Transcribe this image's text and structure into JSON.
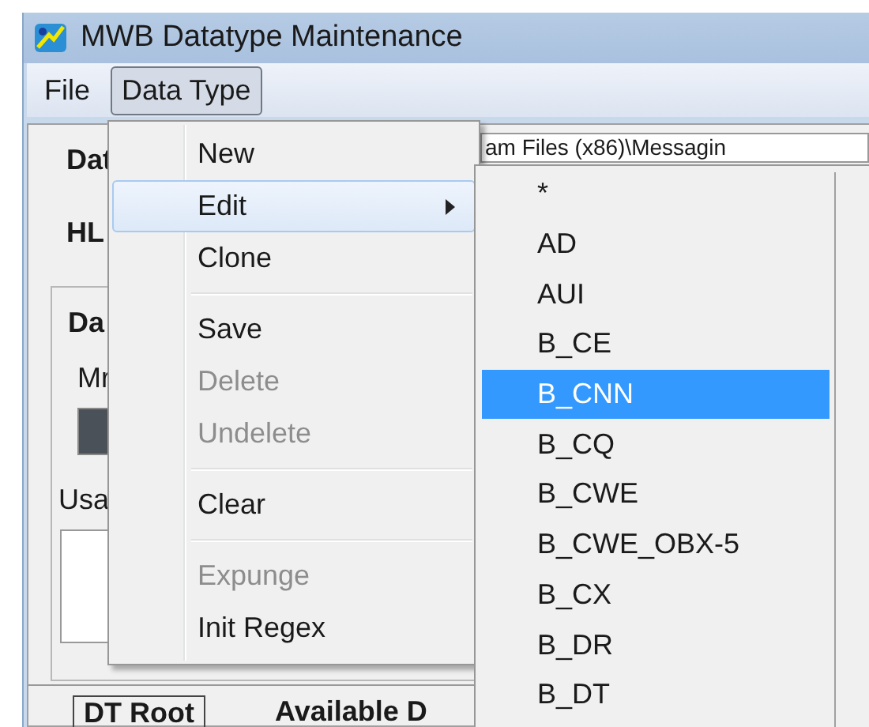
{
  "window": {
    "title": "MWB Datatype Maintenance"
  },
  "menu_bar": [
    {
      "label": "File",
      "selected": false
    },
    {
      "label": "Data Type",
      "selected": true
    }
  ],
  "form": {
    "label_1": "Dat",
    "path_field": "am Files (x86)\\Messagin",
    "label_2": "HL",
    "group_title": "Da",
    "group_label_1": "Mr",
    "group_label_2": "Usa"
  },
  "bottom_bar": {
    "tab": "DT Root",
    "label": "Available D"
  },
  "menu": {
    "items": [
      {
        "kind": "item",
        "label": "New",
        "disabled": false,
        "selected": false,
        "submenu": false
      },
      {
        "kind": "item",
        "label": "Edit",
        "disabled": false,
        "selected": true,
        "submenu": true
      },
      {
        "kind": "item",
        "label": "Clone",
        "disabled": false,
        "selected": false,
        "submenu": false
      },
      {
        "kind": "separator"
      },
      {
        "kind": "item",
        "label": "Save",
        "disabled": false,
        "selected": false,
        "submenu": false
      },
      {
        "kind": "item",
        "label": "Delete",
        "disabled": true,
        "selected": false,
        "submenu": false
      },
      {
        "kind": "item",
        "label": "Undelete",
        "disabled": true,
        "selected": false,
        "submenu": false
      },
      {
        "kind": "separator"
      },
      {
        "kind": "item",
        "label": "Clear",
        "disabled": false,
        "selected": false,
        "submenu": false
      },
      {
        "kind": "separator"
      },
      {
        "kind": "item",
        "label": "Expunge",
        "disabled": true,
        "selected": false,
        "submenu": false
      },
      {
        "kind": "item",
        "label": "Init Regex",
        "disabled": false,
        "selected": false,
        "submenu": false
      }
    ]
  },
  "submenu": {
    "items": [
      {
        "label": "*",
        "selected": false
      },
      {
        "label": "AD",
        "selected": false
      },
      {
        "label": "AUI",
        "selected": false
      },
      {
        "label": "B_CE",
        "selected": false
      },
      {
        "label": "B_CNN",
        "selected": true
      },
      {
        "label": "B_CQ",
        "selected": false
      },
      {
        "label": "B_CWE",
        "selected": false
      },
      {
        "label": "B_CWE_OBX-5",
        "selected": false
      },
      {
        "label": "B_CX",
        "selected": false
      },
      {
        "label": "B_DR",
        "selected": false
      },
      {
        "label": "B_DT",
        "selected": false
      }
    ]
  }
}
